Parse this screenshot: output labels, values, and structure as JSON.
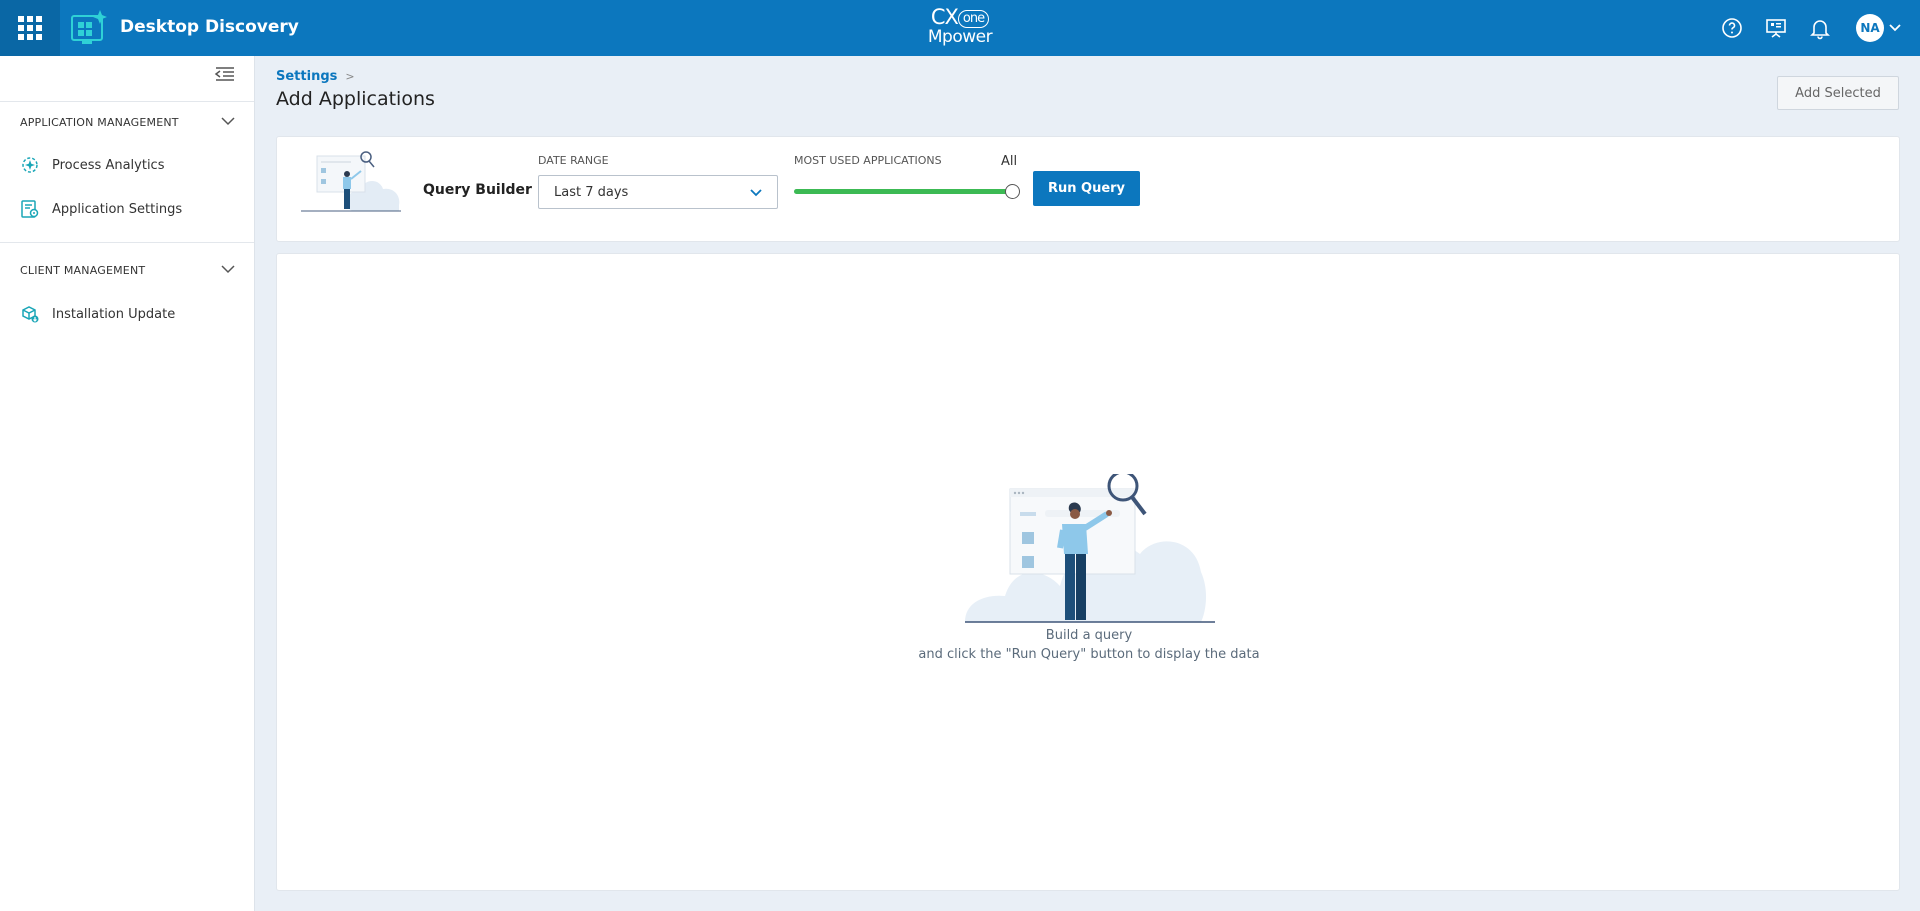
{
  "header": {
    "app_title": "Desktop Discovery",
    "brand_line1": "CX",
    "brand_one": "one",
    "brand_line2": "Mpower",
    "user_initials": "NA"
  },
  "sidebar": {
    "sections": [
      {
        "label": "APPLICATION MANAGEMENT",
        "items": [
          {
            "label": "Process Analytics",
            "icon": "process-analytics-icon"
          },
          {
            "label": "Application Settings",
            "icon": "application-settings-icon"
          }
        ]
      },
      {
        "label": "CLIENT MANAGEMENT",
        "items": [
          {
            "label": "Installation Update",
            "icon": "installation-update-icon"
          }
        ]
      }
    ]
  },
  "main": {
    "breadcrumb": "Settings",
    "breadcrumb_sep": ">",
    "page_title": "Add Applications",
    "add_selected_label": "Add Selected",
    "query": {
      "builder_label": "Query Builder",
      "date_range_label": "DATE RANGE",
      "date_range_value": "Last 7 days",
      "most_used_label": "MOST USED APPLICATIONS",
      "most_used_value": "All",
      "slider_fraction": 1.0,
      "run_label": "Run Query"
    },
    "empty": {
      "line1": "Build a query",
      "line2": "and click the \"Run Query\" button to display the data"
    }
  },
  "colors": {
    "accent": "#0c77be",
    "slider": "#3cba54",
    "teal": "#1aa6b7"
  }
}
